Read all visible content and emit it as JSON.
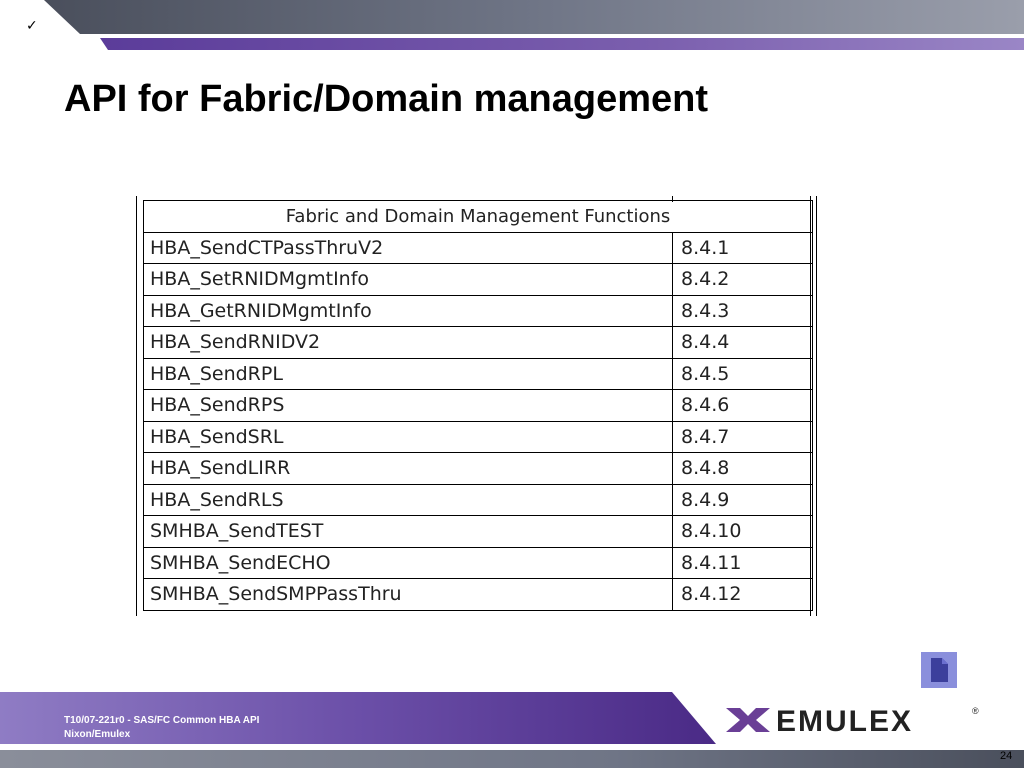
{
  "slide": {
    "title": "API for Fabric/Domain management",
    "checkmark": "✓",
    "page_number": "24"
  },
  "table": {
    "header": "Fabric and Domain Management Functions",
    "rows": [
      {
        "function": "HBA_SendCTPassThruV2",
        "section": "8.4.1"
      },
      {
        "function": "HBA_SetRNIDMgmtInfo",
        "section": "8.4.2"
      },
      {
        "function": "HBA_GetRNIDMgmtInfo",
        "section": "8.4.3"
      },
      {
        "function": "HBA_SendRNIDV2",
        "section": "8.4.4"
      },
      {
        "function": "HBA_SendRPL",
        "section": "8.4.5"
      },
      {
        "function": "HBA_SendRPS",
        "section": "8.4.6"
      },
      {
        "function": "HBA_SendSRL",
        "section": "8.4.7"
      },
      {
        "function": "HBA_SendLIRR",
        "section": "8.4.8"
      },
      {
        "function": "HBA_SendRLS",
        "section": "8.4.9"
      },
      {
        "function": "SMHBA_SendTEST",
        "section": "8.4.10"
      },
      {
        "function": "SMHBA_SendECHO",
        "section": "8.4.11"
      },
      {
        "function": "SMHBA_SendSMPPassThru",
        "section": "8.4.12"
      }
    ]
  },
  "footer": {
    "line1": "T10/07-221r0 - SAS/FC Common HBA API",
    "line2": "Nixon/Emulex"
  },
  "logo": {
    "text": "EMULEX",
    "registered": "®"
  },
  "icons": {
    "document": "document-icon",
    "logo_mark": "emulex-logo-mark"
  },
  "colors": {
    "band_gray": "#6f7586",
    "band_purple": "#7b5fae",
    "footer_purple": "#4a2a86",
    "icon_blue": "#8a8fdc",
    "logo_purple": "#6a3f96"
  }
}
